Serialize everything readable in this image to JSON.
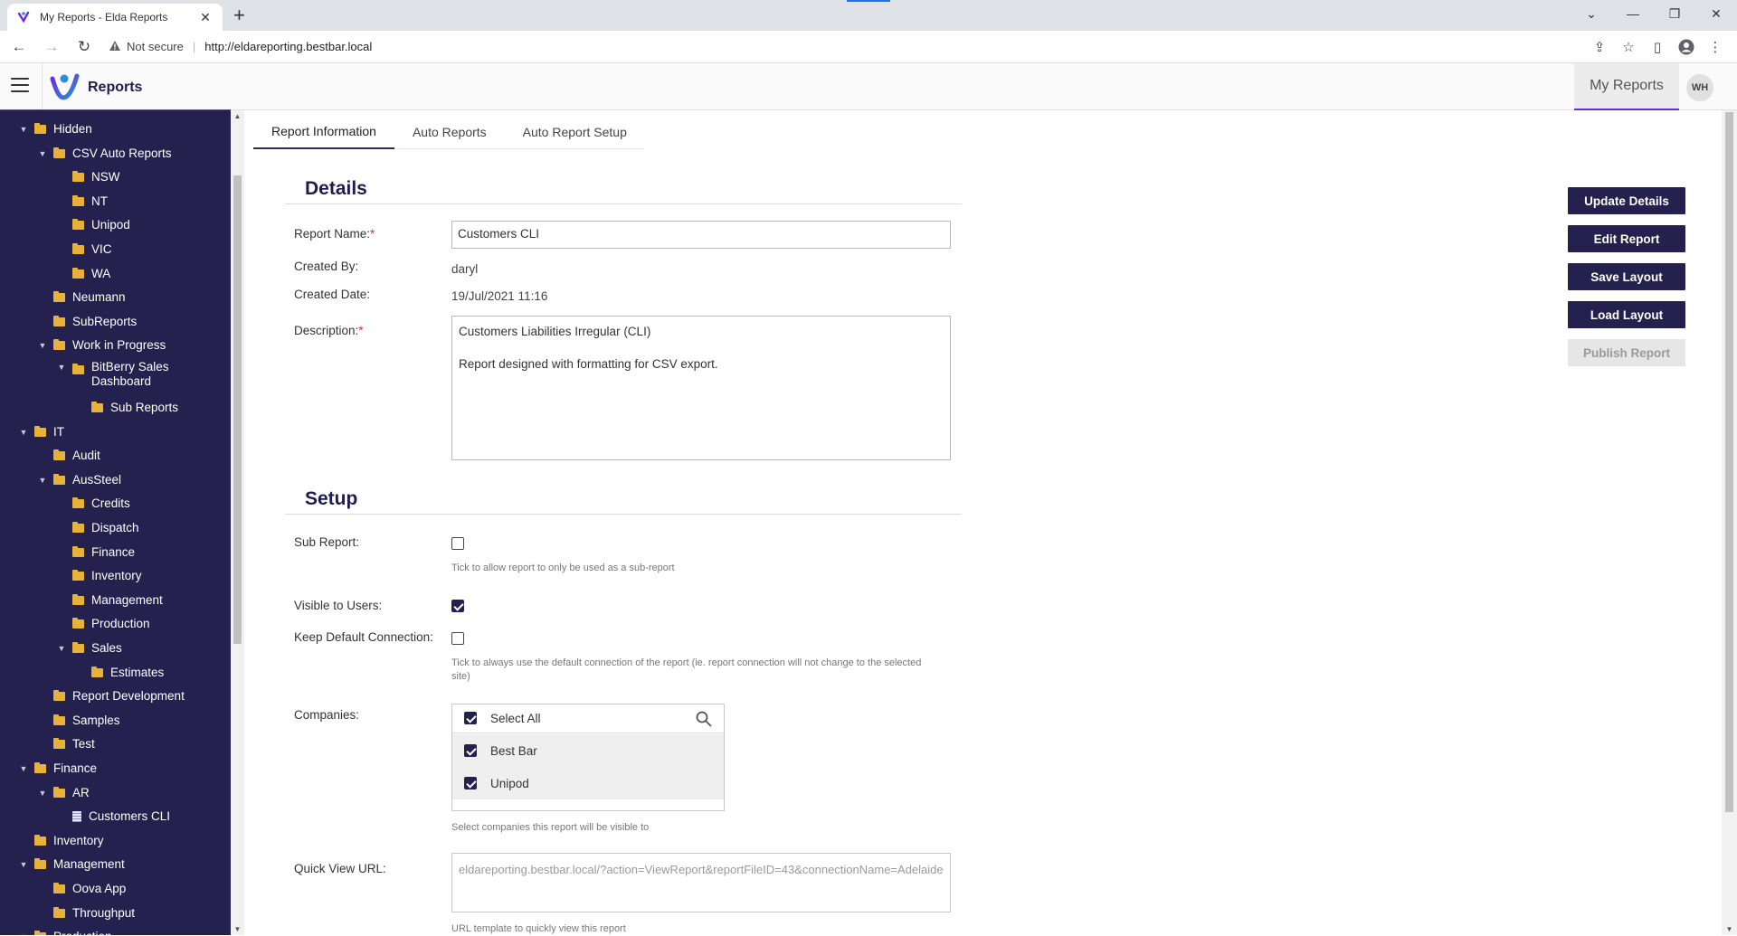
{
  "browser": {
    "tab_title": "My Reports - Elda Reports",
    "tab_close": "✕",
    "new_tab": "+",
    "security_label": "Not secure",
    "url": "http://eldareporting.bestbar.local",
    "window_controls": [
      "⌄",
      "—",
      "❐",
      "✕"
    ]
  },
  "app": {
    "title": "Reports",
    "nav_my_reports": "My Reports",
    "user_initials": "WH",
    "accent_color": "#6c2bd9",
    "brand_color": "#24214f"
  },
  "sidebar": {
    "items": [
      {
        "label": "Hidden",
        "depth": 0,
        "expanded": true,
        "type": "folder"
      },
      {
        "label": "CSV Auto Reports",
        "depth": 1,
        "expanded": true,
        "type": "folder"
      },
      {
        "label": "NSW",
        "depth": 2,
        "type": "folder"
      },
      {
        "label": "NT",
        "depth": 2,
        "type": "folder"
      },
      {
        "label": "Unipod",
        "depth": 2,
        "type": "folder"
      },
      {
        "label": "VIC",
        "depth": 2,
        "type": "folder"
      },
      {
        "label": "WA",
        "depth": 2,
        "type": "folder"
      },
      {
        "label": "Neumann",
        "depth": 1,
        "type": "folder"
      },
      {
        "label": "SubReports",
        "depth": 1,
        "type": "folder"
      },
      {
        "label": "Work in Progress",
        "depth": 1,
        "expanded": true,
        "type": "folder"
      },
      {
        "label": "BitBerry Sales Dashboard",
        "depth": 2,
        "expanded": true,
        "type": "folder",
        "wrap": true
      },
      {
        "label": "Sub Reports",
        "depth": 3,
        "type": "folder"
      },
      {
        "label": "IT",
        "depth": 0,
        "expanded": true,
        "type": "folder"
      },
      {
        "label": "Audit",
        "depth": 1,
        "type": "folder"
      },
      {
        "label": "AusSteel",
        "depth": 1,
        "expanded": true,
        "type": "folder"
      },
      {
        "label": "Credits",
        "depth": 2,
        "type": "folder"
      },
      {
        "label": "Dispatch",
        "depth": 2,
        "type": "folder"
      },
      {
        "label": "Finance",
        "depth": 2,
        "type": "folder"
      },
      {
        "label": "Inventory",
        "depth": 2,
        "type": "folder"
      },
      {
        "label": "Management",
        "depth": 2,
        "type": "folder"
      },
      {
        "label": "Production",
        "depth": 2,
        "type": "folder"
      },
      {
        "label": "Sales",
        "depth": 2,
        "expanded": true,
        "type": "folder"
      },
      {
        "label": "Estimates",
        "depth": 3,
        "type": "folder"
      },
      {
        "label": "Report Development",
        "depth": 1,
        "type": "folder"
      },
      {
        "label": "Samples",
        "depth": 1,
        "type": "folder"
      },
      {
        "label": "Test",
        "depth": 1,
        "type": "folder"
      },
      {
        "label": "Finance",
        "depth": 0,
        "expanded": true,
        "type": "folder"
      },
      {
        "label": "AR",
        "depth": 1,
        "expanded": true,
        "type": "folder"
      },
      {
        "label": "Customers CLI",
        "depth": 2,
        "type": "report"
      },
      {
        "label": "Inventory",
        "depth": 0,
        "type": "folder"
      },
      {
        "label": "Management",
        "depth": 0,
        "expanded": true,
        "type": "folder"
      },
      {
        "label": "Oova App",
        "depth": 1,
        "type": "folder"
      },
      {
        "label": "Throughput",
        "depth": 1,
        "type": "folder"
      },
      {
        "label": "Production",
        "depth": 0,
        "expanded": true,
        "type": "folder"
      }
    ]
  },
  "main": {
    "tabs": [
      "Report Information",
      "Auto Reports",
      "Auto Report Setup"
    ],
    "details": {
      "heading": "Details",
      "report_name_label": "Report Name:",
      "report_name_value": "Customers CLI",
      "created_by_label": "Created By:",
      "created_by_value": "daryl",
      "created_date_label": "Created Date:",
      "created_date_value": "19/Jul/2021 11:16",
      "description_label": "Description:",
      "description_value": "Customers Liabilities Irregular (CLI)\n\nReport designed with formatting for CSV export.",
      "required_mark": "*"
    },
    "setup": {
      "heading": "Setup",
      "sub_report_label": "Sub Report:",
      "sub_report_checked": false,
      "sub_report_hint": "Tick to allow report to only be used as a sub-report",
      "visible_label": "Visible to Users:",
      "visible_checked": true,
      "keep_conn_label": "Keep Default Connection:",
      "keep_conn_checked": false,
      "keep_conn_hint": "Tick to always use the default connection of the report (ie. report connection will not change to the selected site)",
      "companies_label": "Companies:",
      "select_all_label": "Select All",
      "companies": [
        {
          "name": "Best Bar",
          "checked": true
        },
        {
          "name": "Unipod",
          "checked": true
        }
      ],
      "companies_hint": "Select companies this report will be visible to",
      "quick_view_label": "Quick View URL:",
      "quick_view_value": "eldareporting.bestbar.local/?action=ViewReport&reportFileID=43&connectionName=Adelaide",
      "quick_view_hint": "URL template to quickly view this report"
    },
    "actions": {
      "update_details": "Update Details",
      "edit_report": "Edit Report",
      "save_layout": "Save Layout",
      "load_layout": "Load Layout",
      "publish_report": "Publish Report"
    }
  }
}
